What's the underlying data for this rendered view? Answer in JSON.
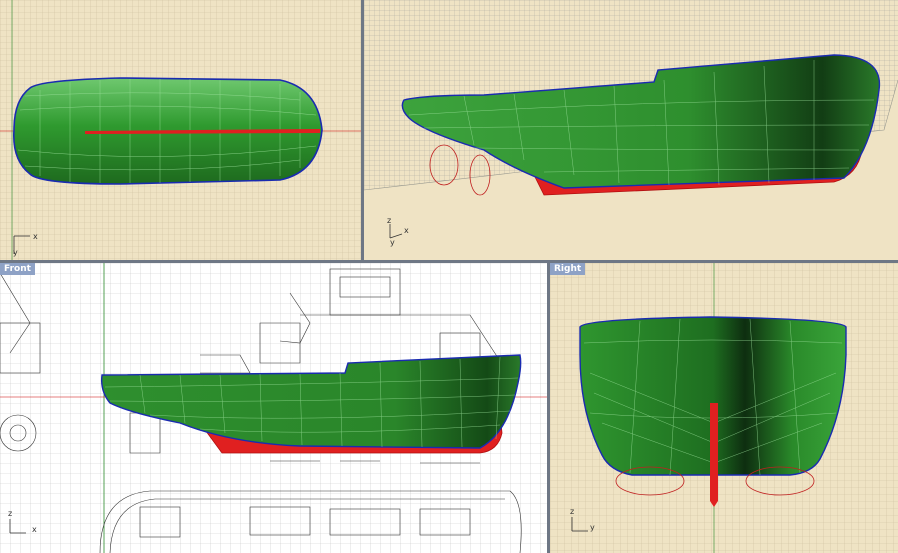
{
  "viewports": {
    "top": {
      "label": "",
      "axis_x": "x",
      "axis_y": "y"
    },
    "perspective": {
      "label": "",
      "axis_x": "x",
      "axis_y": "y",
      "axis_z": "z"
    },
    "front": {
      "label": "Front",
      "axis_x": "x",
      "axis_z": "z"
    },
    "right": {
      "label": "Right",
      "axis_y": "y",
      "axis_z": "z"
    }
  },
  "colors": {
    "background": "#efe3c4",
    "grid": "#c9bc9c",
    "hull_green": "#2e8b2e",
    "hull_dark": "#0f3a12",
    "keel_red": "#e02020",
    "sheer_blue": "#1a2bb0",
    "label_bg": "#8ea2c6"
  }
}
